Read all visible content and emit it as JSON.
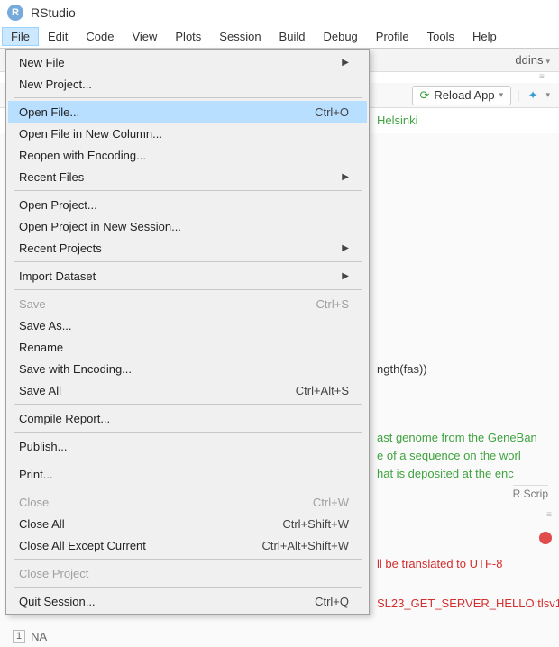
{
  "app": {
    "title": "RStudio",
    "icon_letter": "R"
  },
  "menu_bar": [
    "File",
    "Edit",
    "Code",
    "View",
    "Plots",
    "Session",
    "Build",
    "Debug",
    "Profile",
    "Tools",
    "Help"
  ],
  "active_menu_index": 0,
  "file_menu": [
    {
      "type": "item",
      "label": "New File",
      "submenu": true
    },
    {
      "type": "item",
      "label": "New Project..."
    },
    {
      "type": "sep"
    },
    {
      "type": "item",
      "label": "Open File...",
      "shortcut": "Ctrl+O",
      "highlighted": true
    },
    {
      "type": "item",
      "label": "Open File in New Column..."
    },
    {
      "type": "item",
      "label": "Reopen with Encoding..."
    },
    {
      "type": "item",
      "label": "Recent Files",
      "submenu": true
    },
    {
      "type": "sep"
    },
    {
      "type": "item",
      "label": "Open Project..."
    },
    {
      "type": "item",
      "label": "Open Project in New Session..."
    },
    {
      "type": "item",
      "label": "Recent Projects",
      "submenu": true
    },
    {
      "type": "sep"
    },
    {
      "type": "item",
      "label": "Import Dataset",
      "submenu": true
    },
    {
      "type": "sep"
    },
    {
      "type": "item",
      "label": "Save",
      "shortcut": "Ctrl+S",
      "disabled": true
    },
    {
      "type": "item",
      "label": "Save As..."
    },
    {
      "type": "item",
      "label": "Rename"
    },
    {
      "type": "item",
      "label": "Save with Encoding..."
    },
    {
      "type": "item",
      "label": "Save All",
      "shortcut": "Ctrl+Alt+S"
    },
    {
      "type": "sep"
    },
    {
      "type": "item",
      "label": "Compile Report..."
    },
    {
      "type": "sep"
    },
    {
      "type": "item",
      "label": "Publish..."
    },
    {
      "type": "sep"
    },
    {
      "type": "item",
      "label": "Print..."
    },
    {
      "type": "sep"
    },
    {
      "type": "item",
      "label": "Close",
      "shortcut": "Ctrl+W",
      "disabled": true
    },
    {
      "type": "item",
      "label": "Close All",
      "shortcut": "Ctrl+Shift+W"
    },
    {
      "type": "item",
      "label": "Close All Except Current",
      "shortcut": "Ctrl+Alt+Shift+W"
    },
    {
      "type": "sep"
    },
    {
      "type": "item",
      "label": "Close Project",
      "disabled": true
    },
    {
      "type": "sep"
    },
    {
      "type": "item",
      "label": "Quit Session...",
      "shortcut": "Ctrl+Q"
    }
  ],
  "toolbar": {
    "addins_label": "ddins",
    "reload_label": "Reload App"
  },
  "code_visible": {
    "line1": "Helsinki",
    "line_len": "ngth(fas))",
    "block1_a": "ast genome from the GeneBan",
    "block1_b": "e of a sequence on the worl",
    "block1_c": "hat is deposited at the enc",
    "tab_label": "R Scrip",
    "warn": "ll be translated to UTF-8",
    "err": "SL23_GET_SERVER_HELLO:tlsv1"
  },
  "status": {
    "index": "1",
    "value": "NA"
  }
}
